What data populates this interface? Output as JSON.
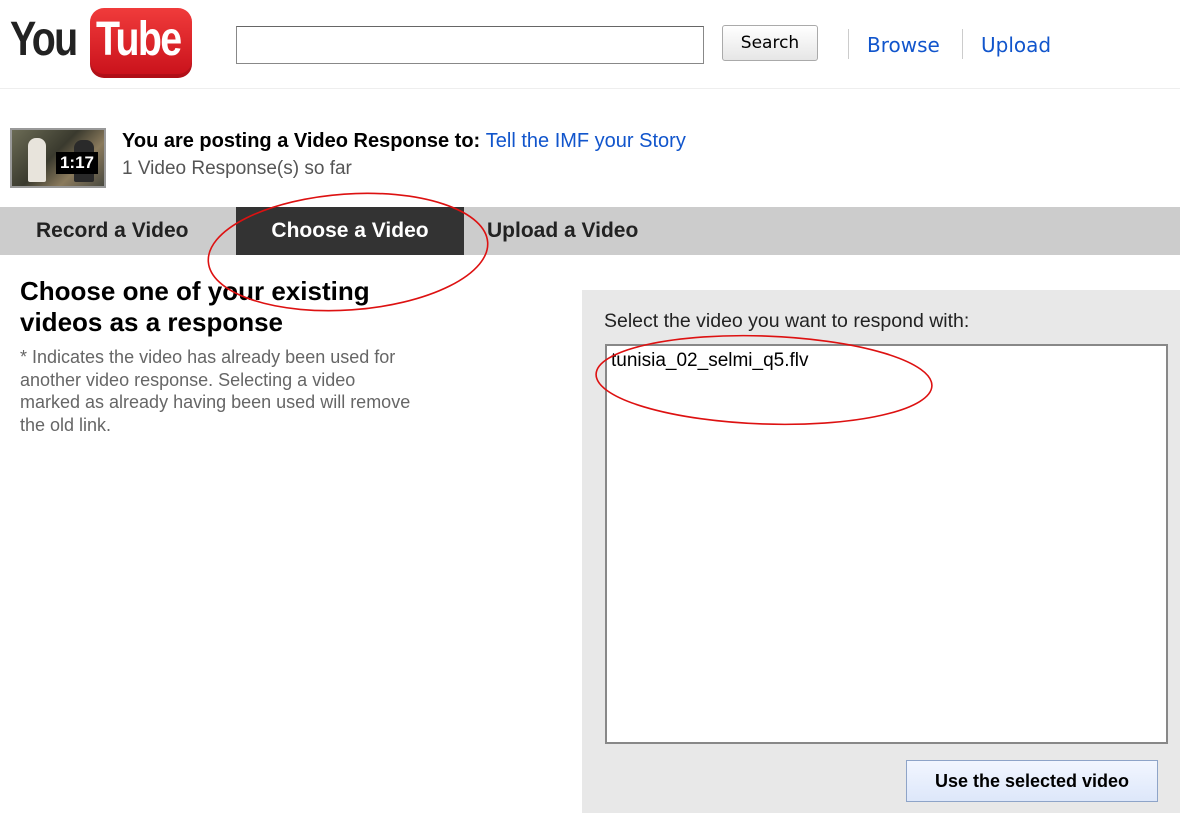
{
  "header": {
    "logo": {
      "you": "You",
      "tube": "Tube"
    },
    "search": {
      "value": "",
      "button_label": "Search"
    },
    "nav": [
      {
        "label": "Browse"
      },
      {
        "label": "Upload"
      }
    ]
  },
  "response_info": {
    "thumbnail_duration": "1:17",
    "posting_prefix": "You are posting a Video Response to:",
    "video_title": "Tell the IMF your Story",
    "response_count_text": "1 Video Response(s) so far"
  },
  "tabs": [
    {
      "label": "Record a Video",
      "active": false
    },
    {
      "label": "Choose a Video",
      "active": true
    },
    {
      "label": "Upload a Video",
      "active": false
    }
  ],
  "left": {
    "heading": "Choose one of your existing videos as a response",
    "note": "* Indicates the video has already been used for another video response. Selecting a video marked as already having been used will remove the old link."
  },
  "right": {
    "select_label": "Select the video you want to respond with:",
    "videos": [
      "tunisia_02_selmi_q5.flv"
    ],
    "submit_label": "Use the selected video"
  },
  "colors": {
    "link": "#1155cc",
    "tab_bar": "#cccccc",
    "tab_active": "#333333",
    "annotation": "#dd1111",
    "logo_red": "#e02a2a"
  }
}
